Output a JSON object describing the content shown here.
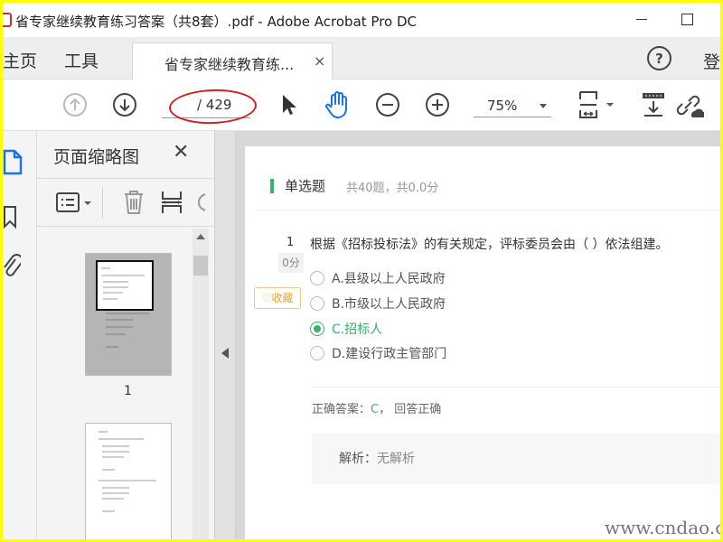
{
  "window": {
    "title": "省专家继续教育练习答案（共8套）.pdf - Adobe Acrobat Pro DC"
  },
  "menu": {
    "home": "主页",
    "tools": "工具",
    "login": "登"
  },
  "doc_tab": {
    "label": "省专家继续教育练...",
    "close": "×"
  },
  "toolbar": {
    "page_total": "/ 429",
    "zoom": "75%",
    "accent_color": "#1a73e8",
    "annotation_color": "#d42020"
  },
  "thumbnails_panel": {
    "title": "页面缩略图",
    "close": "✕",
    "pages": [
      {
        "label": "1"
      }
    ]
  },
  "document": {
    "section": {
      "title": "单选题",
      "meta": "共40题，共0.0分"
    },
    "question": {
      "number": "1",
      "score": "0分",
      "text": "根据《招标投标法》的有关规定，评标委员会由（ ）依法组建。",
      "favorite": "♡收藏",
      "options": [
        {
          "label": "A.县级以上人民政府",
          "selected": false
        },
        {
          "label": "B.市级以上人民政府",
          "selected": false
        },
        {
          "label": "C.招标人",
          "selected": true
        },
        {
          "label": "D.建设行政主管部门",
          "selected": false
        }
      ],
      "answer_prefix": "正确答案：",
      "answer_letter": "C",
      "answer_suffix": "，  回答正确",
      "explanation_label": "解析：",
      "explanation_value": "无解析"
    },
    "accent_color": "#39b36b"
  },
  "watermark": "www.cndao.com"
}
